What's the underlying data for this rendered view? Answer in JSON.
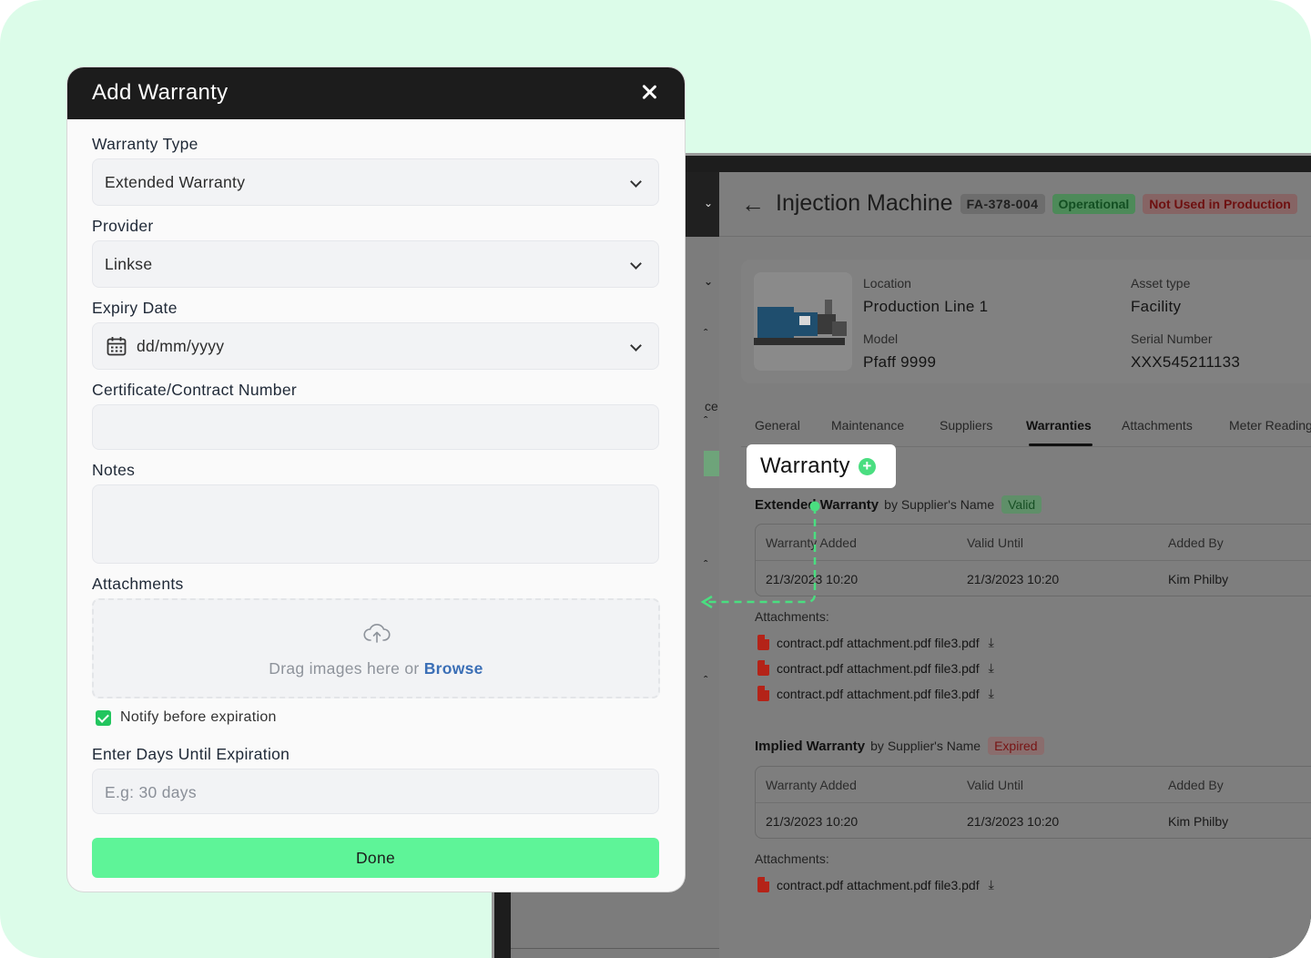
{
  "modal": {
    "title": "Add Warranty",
    "warranty_type": {
      "label": "Warranty Type",
      "value": "Extended Warranty"
    },
    "provider": {
      "label": "Provider",
      "value": "Linkse"
    },
    "expiry_date": {
      "label": "Expiry Date",
      "placeholder": "dd/mm/yyyy"
    },
    "certificate": {
      "label": "Certificate/Contract Number",
      "value": ""
    },
    "notes": {
      "label": "Notes",
      "value": ""
    },
    "attachments": {
      "label": "Attachments",
      "drag_text": "Drag images here or ",
      "browse_text": "Browse"
    },
    "notify": {
      "label": "Notify before expiration",
      "checked": true
    },
    "days": {
      "label": "Enter Days Until Expiration",
      "placeholder": "E.g: 30 days"
    },
    "done_label": "Done"
  },
  "asset": {
    "title": "Injection Machine",
    "id_badge": "FA-378-004",
    "status_badge": "Operational",
    "usage_badge": "Not Used in Production",
    "info": {
      "location_label": "Location",
      "location_value": "Production Line 1",
      "asset_type_label": "Asset type",
      "asset_type_value": "Facility",
      "model_label": "Model",
      "model_value": "Pfaff 9999",
      "serial_label": "Serial Number",
      "serial_value": "XXX545211133"
    },
    "tabs": [
      "General",
      "Maintenance",
      "Suppliers",
      "Warranties",
      "Attachments",
      "Meter Readings"
    ],
    "active_tab": "Warranties",
    "warranty_callout": "Warranty",
    "warranties": [
      {
        "name": "Extended Warranty",
        "by": "by Supplier's Name",
        "status": "Valid",
        "headers": [
          "Warranty Added",
          "Valid Until",
          "Added By"
        ],
        "row": [
          "21/3/2023 10:20",
          "21/3/2023 10:20",
          "Kim Philby"
        ],
        "attachments_label": "Attachments:",
        "files": [
          "contract.pdf attachment.pdf file3.pdf",
          "contract.pdf attachment.pdf file3.pdf",
          "contract.pdf attachment.pdf file3.pdf"
        ]
      },
      {
        "name": "Implied Warranty",
        "by": "by Supplier's Name",
        "status": "Expired",
        "headers": [
          "Warranty Added",
          "Valid Until",
          "Added By"
        ],
        "row": [
          "21/3/2023 10:20",
          "21/3/2023 10:20",
          "Kim Philby"
        ],
        "attachments_label": "Attachments:",
        "files": [
          "contract.pdf attachment.pdf file3.pdf"
        ]
      }
    ],
    "sidebar_fragment": "ce"
  },
  "colors": {
    "canvas_bg": "#dcfce9",
    "accent_green": "#5ef498",
    "modal_header": "#1c1c1c",
    "browse_link": "#3b6fb6",
    "connector": "#4ade80"
  },
  "icons": [
    "close-icon",
    "chevron-down-icon",
    "calendar-icon",
    "upload-cloud-icon",
    "checkbox-checked-icon",
    "back-arrow-icon",
    "plus-circle-icon",
    "pdf-file-icon",
    "download-icon"
  ]
}
